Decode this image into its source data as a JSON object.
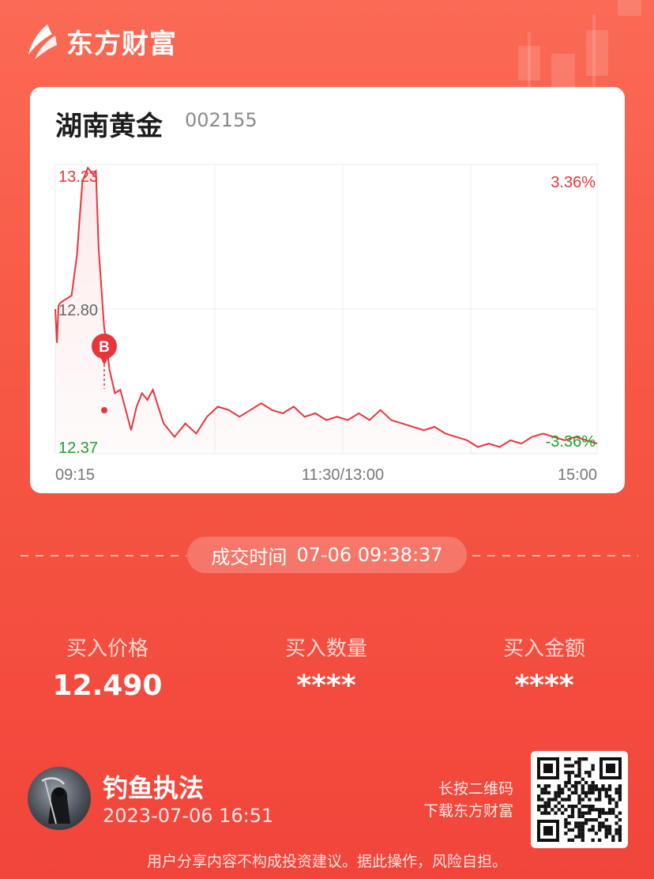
{
  "brand": {
    "name": "东方财富"
  },
  "stock": {
    "name": "湖南黄金",
    "code": "002155"
  },
  "chart_data": {
    "type": "line",
    "y_max_label": "13.23",
    "y_mid_label": "12.80",
    "y_min_label": "12.37",
    "pct_max_label": "3.36%",
    "pct_min_label": "-3.36%",
    "x_labels": [
      "09:15",
      "11:30/13:00",
      "15:00"
    ],
    "marker_label": "B",
    "ylim": [
      12.37,
      13.23
    ],
    "price_points": [
      [
        0.0,
        12.8
      ],
      [
        0.3,
        12.7
      ],
      [
        0.6,
        12.81
      ],
      [
        1.0,
        12.82
      ],
      [
        2.0,
        12.83
      ],
      [
        3.0,
        12.84
      ],
      [
        4.0,
        12.96
      ],
      [
        5.0,
        13.18
      ],
      [
        6.0,
        13.22
      ],
      [
        7.0,
        13.2
      ],
      [
        7.5,
        13.21
      ],
      [
        8.0,
        12.98
      ],
      [
        9.0,
        12.75
      ],
      [
        10.0,
        12.62
      ],
      [
        11.0,
        12.55
      ],
      [
        12.0,
        12.56
      ],
      [
        13.0,
        12.5
      ],
      [
        14.0,
        12.44
      ],
      [
        15.0,
        12.51
      ],
      [
        16.0,
        12.55
      ],
      [
        17.0,
        12.53
      ],
      [
        18.0,
        12.56
      ],
      [
        19.0,
        12.51
      ],
      [
        20.0,
        12.46
      ],
      [
        22.0,
        12.42
      ],
      [
        24.0,
        12.46
      ],
      [
        26.0,
        12.43
      ],
      [
        28.0,
        12.48
      ],
      [
        30.0,
        12.51
      ],
      [
        32.0,
        12.5
      ],
      [
        34.0,
        12.48
      ],
      [
        36.0,
        12.5
      ],
      [
        38.0,
        12.52
      ],
      [
        40.0,
        12.5
      ],
      [
        42.0,
        12.49
      ],
      [
        44.0,
        12.51
      ],
      [
        46.0,
        12.48
      ],
      [
        48.0,
        12.49
      ],
      [
        50.0,
        12.47
      ],
      [
        52.0,
        12.48
      ],
      [
        54.0,
        12.47
      ],
      [
        56.0,
        12.49
      ],
      [
        58.0,
        12.47
      ],
      [
        60.0,
        12.5
      ],
      [
        62.0,
        12.47
      ],
      [
        64.0,
        12.46
      ],
      [
        66.0,
        12.45
      ],
      [
        68.0,
        12.44
      ],
      [
        70.0,
        12.45
      ],
      [
        72.0,
        12.43
      ],
      [
        74.0,
        12.42
      ],
      [
        76.0,
        12.41
      ],
      [
        78.0,
        12.39
      ],
      [
        80.0,
        12.4
      ],
      [
        82.0,
        12.39
      ],
      [
        84.0,
        12.41
      ],
      [
        86.0,
        12.4
      ],
      [
        88.0,
        12.42
      ],
      [
        90.0,
        12.43
      ],
      [
        92.0,
        12.42
      ],
      [
        94.0,
        12.41
      ],
      [
        96.0,
        12.42
      ],
      [
        98.0,
        12.41
      ],
      [
        100.0,
        12.4
      ]
    ]
  },
  "trade_time": {
    "label": "成交时间",
    "value": "07-06 09:38:37"
  },
  "stats": {
    "price": {
      "label": "买入价格",
      "value": "12.490"
    },
    "quantity": {
      "label": "买入数量",
      "value": "****"
    },
    "amount": {
      "label": "买入金额",
      "value": "****"
    }
  },
  "user": {
    "name": "钓鱼执法",
    "datetime": "2023-07-06 16:51"
  },
  "qr": {
    "hint_line1": "长按二维码",
    "hint_line2": "下载东方财富"
  },
  "disclaimer": "用户分享内容不构成投资建议。据此操作，风险自担。",
  "colors": {
    "up": "#e8353b",
    "down": "#1fa02f",
    "card_bg": "#ffffff",
    "bg_top": "#fb6a56",
    "bg_bottom": "#f1453b"
  },
  "icons": [
    "brand-logo-icon",
    "buy-marker-icon",
    "avatar-image",
    "qr-code-image"
  ]
}
